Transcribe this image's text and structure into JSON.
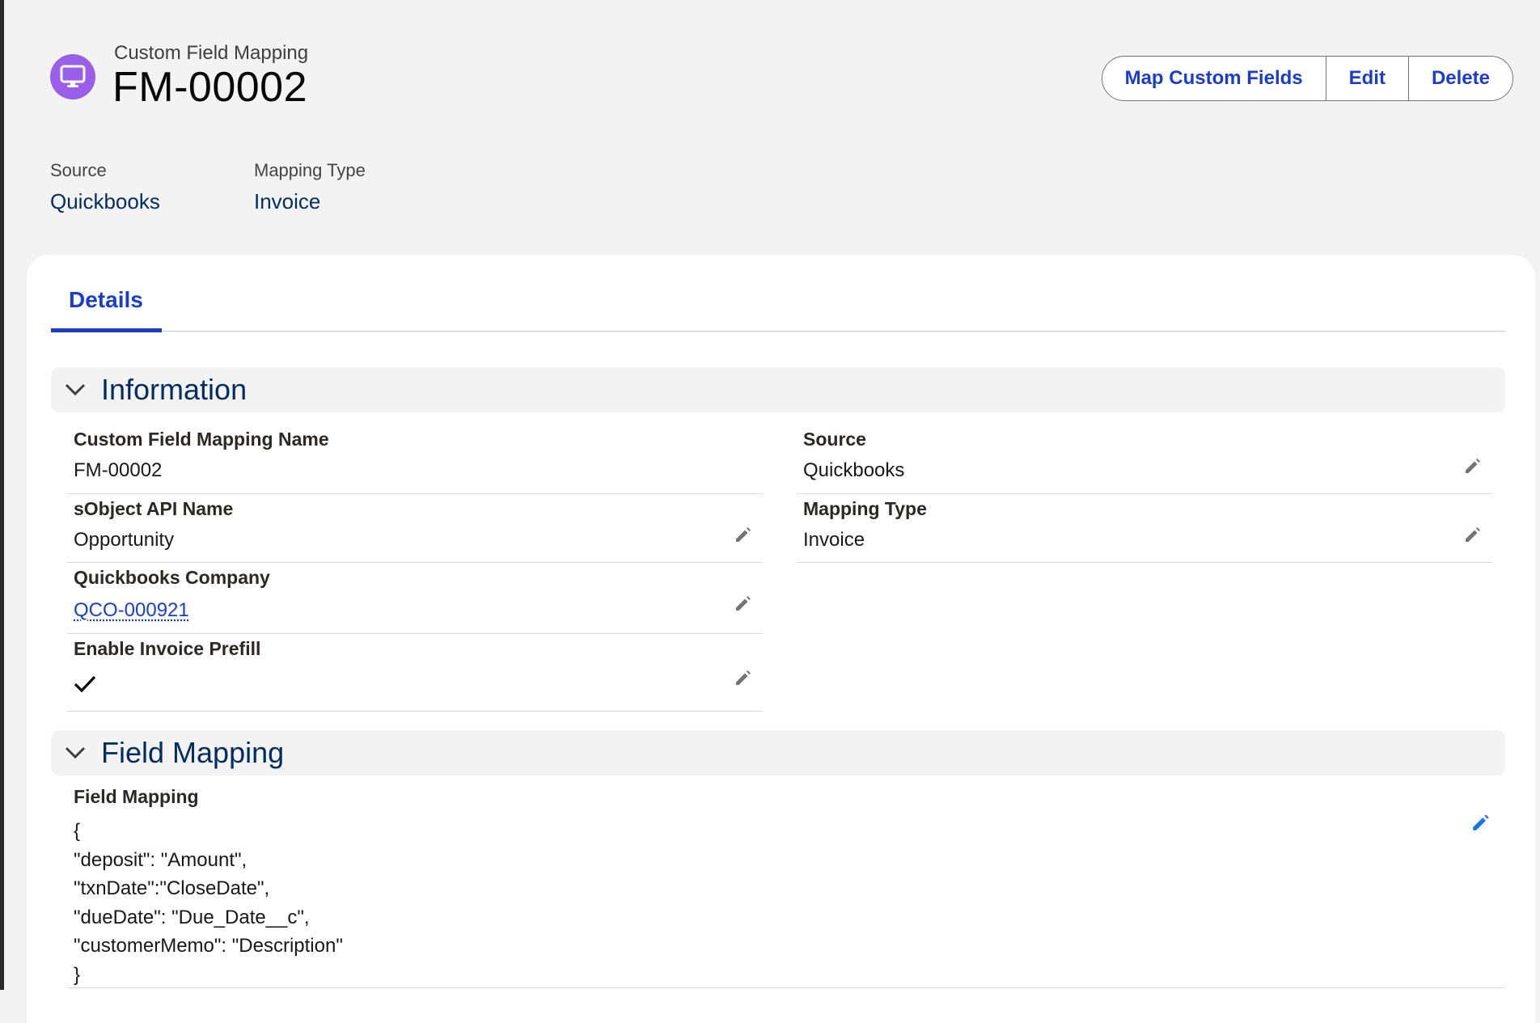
{
  "header": {
    "object_type": "Custom Field Mapping",
    "record_title": "FM-00002",
    "icon": "monitor-icon",
    "icon_color": "#9b5ee8",
    "actions": [
      "Map Custom Fields",
      "Edit",
      "Delete"
    ],
    "highlights": [
      {
        "label": "Source",
        "value": "Quickbooks"
      },
      {
        "label": "Mapping Type",
        "value": "Invoice"
      }
    ]
  },
  "tabs": [
    {
      "label": "Details",
      "active": true
    }
  ],
  "sections": {
    "information": {
      "title": "Information",
      "fields": {
        "name": {
          "label": "Custom Field Mapping Name",
          "value": "FM-00002"
        },
        "sobject": {
          "label": "sObject API Name",
          "value": "Opportunity"
        },
        "company": {
          "label": "Quickbooks Company",
          "value": "QCO-000921"
        },
        "prefill": {
          "label": "Enable Invoice Prefill",
          "value": "checked"
        },
        "source": {
          "label": "Source",
          "value": "Quickbooks"
        },
        "mapping_type": {
          "label": "Mapping Type",
          "value": "Invoice"
        }
      }
    },
    "field_mapping": {
      "title": "Field Mapping",
      "label": "Field Mapping",
      "lines": [
        "{",
        "\"deposit\": \"Amount\",",
        "\"txnDate\":\"CloseDate\",",
        "\"dueDate\": \"Due_Date__c\",",
        "\"customerMemo\": \"Description\"",
        "}"
      ]
    }
  },
  "colors": {
    "accent": "#1a3ecb",
    "title": "#032d60",
    "page_bg": "#f3f3f3",
    "active_edit_icon": "#1a73e8"
  }
}
